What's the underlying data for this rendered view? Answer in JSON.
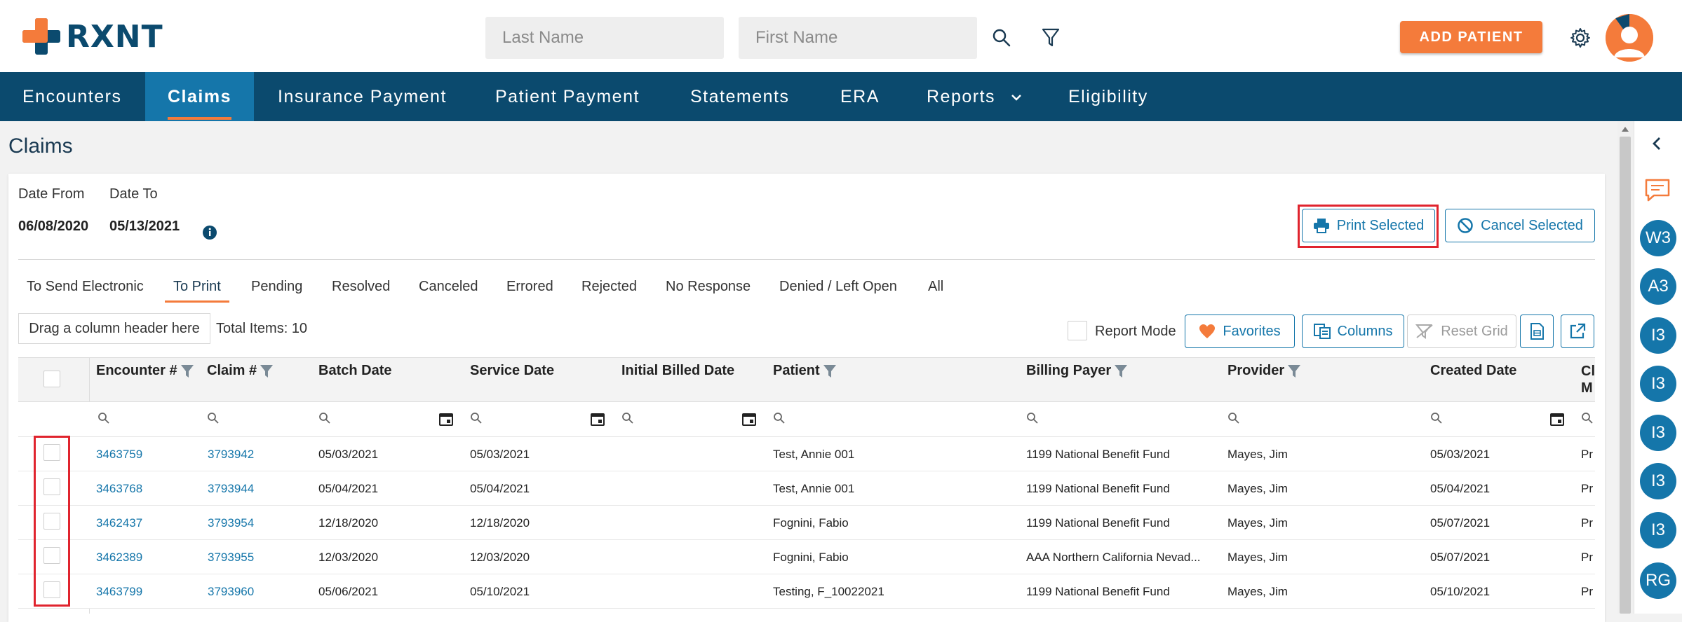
{
  "app": {
    "logo_text": "RXNT",
    "colors": {
      "brand": "#0b4a6e",
      "accent": "#f47b3b",
      "link": "#1576aa",
      "highlight": "#e0242e"
    }
  },
  "header": {
    "last_name_placeholder": "Last Name",
    "first_name_placeholder": "First Name",
    "search_icon": "search-icon",
    "filter_icon": "filter-icon",
    "add_patient_label": "ADD PATIENT",
    "settings_icon": "gear-icon",
    "avatar_icon": "user-avatar-icon"
  },
  "nav": {
    "items": [
      {
        "label": "Encounters"
      },
      {
        "label": "Claims",
        "active": true
      },
      {
        "label": "Insurance Payment"
      },
      {
        "label": "Patient Payment"
      },
      {
        "label": "Statements"
      },
      {
        "label": "ERA"
      },
      {
        "label": "Reports"
      },
      {
        "label": "Eligibility"
      }
    ]
  },
  "page": {
    "title": "Claims",
    "date_from_label": "Date From",
    "date_to_label": "Date To",
    "date_from": "06/08/2020",
    "date_to": "05/13/2021",
    "print_selected_label": "Print Selected",
    "cancel_selected_label": "Cancel Selected"
  },
  "tabs": [
    "To Send Electronic",
    "To Print",
    "Pending",
    "Resolved",
    "Canceled",
    "Errored",
    "Rejected",
    "No Response",
    "Denied / Left Open",
    "All"
  ],
  "active_tab": "To Print",
  "toolbar": {
    "drag_hint": "Drag a column header here",
    "total_items": "Total Items: 10",
    "report_mode_label": "Report Mode",
    "favorites_label": "Favorites",
    "columns_label": "Columns",
    "reset_grid_label": "Reset Grid"
  },
  "grid": {
    "columns": [
      "Encounter #",
      "Claim #",
      "Batch Date",
      "Service Date",
      "Initial Billed Date",
      "Patient",
      "Billing Payer",
      "Provider",
      "Created Date",
      "Cl\nM"
    ],
    "rows": [
      {
        "encounter": "3463759",
        "claim": "3793942",
        "batch": "05/03/2021",
        "service": "05/03/2021",
        "patient": "Test, Annie 001",
        "payer": "1199 National Benefit Fund",
        "provider": "Mayes, Jim",
        "created": "05/03/2021",
        "extra": "Pr"
      },
      {
        "encounter": "3463768",
        "claim": "3793944",
        "batch": "05/04/2021",
        "service": "05/04/2021",
        "patient": "Test, Annie 001",
        "payer": "1199 National Benefit Fund",
        "provider": "Mayes, Jim",
        "created": "05/04/2021",
        "extra": "Pr"
      },
      {
        "encounter": "3462437",
        "claim": "3793954",
        "batch": "12/18/2020",
        "service": "12/18/2020",
        "patient": "Fognini, Fabio",
        "payer": "1199 National Benefit Fund",
        "provider": "Mayes, Jim",
        "created": "05/07/2021",
        "extra": "Pr"
      },
      {
        "encounter": "3462389",
        "claim": "3793955",
        "batch": "12/03/2020",
        "service": "12/03/2020",
        "patient": "Fognini, Fabio",
        "payer": "AAA Northern California Nevad...",
        "provider": "Mayes, Jim",
        "created": "05/07/2021",
        "extra": "Pr"
      },
      {
        "encounter": "3463799",
        "claim": "3793960",
        "batch": "05/06/2021",
        "service": "05/10/2021",
        "patient": "Testing, F_10022021",
        "payer": "1199 National Benefit Fund",
        "provider": "Mayes, Jim",
        "created": "05/10/2021",
        "extra": "Pr"
      }
    ]
  },
  "sidebar": {
    "collapse_icon": "chevron-left-icon",
    "chat_icon": "chat-icon",
    "items": [
      "W3",
      "A3",
      "I3",
      "I3",
      "I3",
      "I3",
      "I3",
      "RG"
    ]
  }
}
